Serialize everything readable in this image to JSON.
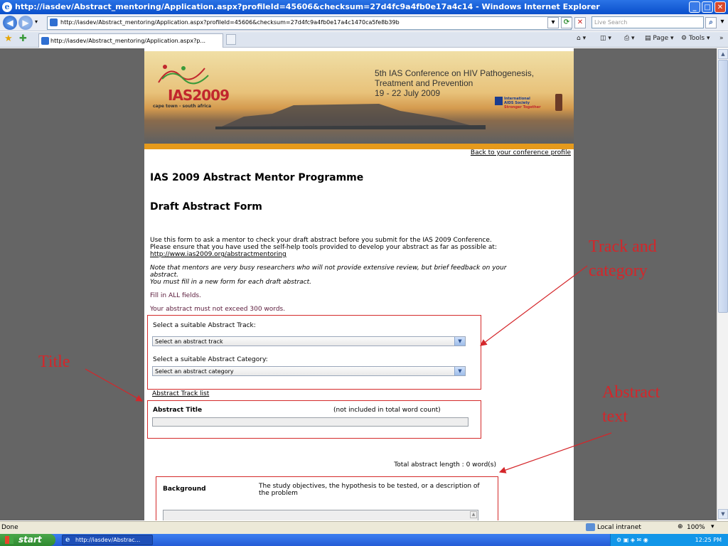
{
  "window": {
    "title": "http://iasdev/Abstract_mentoring/Application.aspx?profileId=45606&checksum=27d4fc9a4fb0e17a4c14 - Windows Internet Explorer"
  },
  "addressbar": {
    "url": "http://iasdev/Abstract_mentoring/Application.aspx?profileId=45606&checksum=27d4fc9a4fb0e17a4c1470ca5fe8b39b",
    "search_placeholder": "Live Search"
  },
  "tabbar": {
    "tab_title": "http://iasdev/Abstract_mentoring/Application.aspx?p...",
    "page_label": "Page",
    "tools_label": "Tools"
  },
  "banner": {
    "logo_text": "IAS2009",
    "logo_subtitle": "cape town - south africa",
    "conf_line1": "5th IAS Conference on HIV Pathogenesis,",
    "conf_line2": "Treatment and Prevention",
    "conf_line3": "19 - 22 July 2009",
    "society_line1": "International",
    "society_line2": "AIDS Society",
    "society_line3": "Stronger Together"
  },
  "page": {
    "back_link": "Back to your conference profile",
    "title": "IAS 2009 Abstract Mentor Programme",
    "subtitle": "Draft Abstract Form",
    "intro_line1": "Use this form to ask a mentor to check your draft abstract before you submit for the IAS 2009 Conference.",
    "intro_line2": "Please ensure that you have used the self-help tools provided to develop your abstract as far as possible at:",
    "intro_link": "http://www.ias2009.org/abstractmentoring",
    "note_line1": "Note that mentors are very busy researchers who will not provide extensive review, but brief feedback on your",
    "note_line2": "abstract.",
    "note_line3": "You must fill in a new form for each draft abstract.",
    "fill_all": "Fill in ALL fields.",
    "word_limit": "Your abstract must not exceed 300 words.",
    "track_label": "Select a suitable Abstract Track:",
    "track_value": "Select an abstract track",
    "category_label": "Select a suitable Abstract Category:",
    "category_value": "Select an abstract category",
    "track_list_link": "Abstract Track list",
    "abstract_title_label": "Abstract Title",
    "abstract_title_note": "(not included in total word count)",
    "total_length": "Total abstract length : 0 word(s)",
    "background_label": "Background",
    "background_desc_line1": "The study objectives, the hypothesis to be tested, or a description of",
    "background_desc_line2": "the problem"
  },
  "annotations": {
    "track_category_line1": "Track and",
    "track_category_line2": "category",
    "title": "Title",
    "abstract_line1": "Abstract",
    "abstract_line2": "text"
  },
  "statusbar": {
    "status": "Done",
    "zone": "Local intranet",
    "zoom": "100%"
  },
  "taskbar": {
    "start": "start",
    "task_item": "http://iasdev/Abstrac...",
    "clock": "12:25 PM"
  },
  "colors": {
    "annotation_red": "#d4262a",
    "titlebar_blue": "#0a4fcb",
    "banner_orange": "#e59a1c"
  }
}
